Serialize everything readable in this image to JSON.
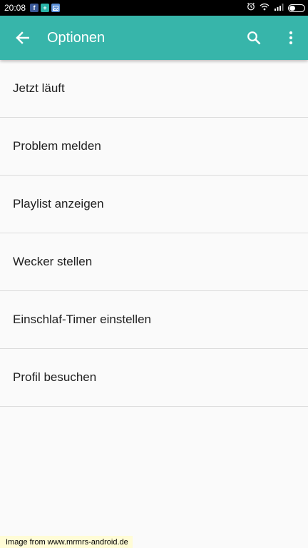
{
  "status_bar": {
    "time": "20:08",
    "notification_icons": [
      "facebook-icon",
      "plus-icon",
      "gallery-icon"
    ],
    "right_icons": [
      "alarm-icon",
      "wifi-icon",
      "signal-icon",
      "battery-icon"
    ]
  },
  "app_bar": {
    "title": "Optionen",
    "color": "#37b5aa",
    "icons": [
      "back-arrow-icon",
      "search-icon",
      "more-vert-icon"
    ]
  },
  "menu": {
    "items": [
      {
        "label": "Jetzt läuft"
      },
      {
        "label": "Problem melden"
      },
      {
        "label": "Playlist anzeigen"
      },
      {
        "label": "Wecker stellen"
      },
      {
        "label": "Einschlaf-Timer einstellen"
      },
      {
        "label": "Profil besuchen"
      }
    ]
  },
  "watermark": {
    "text": "Image from www.mrmrs-android.de"
  }
}
